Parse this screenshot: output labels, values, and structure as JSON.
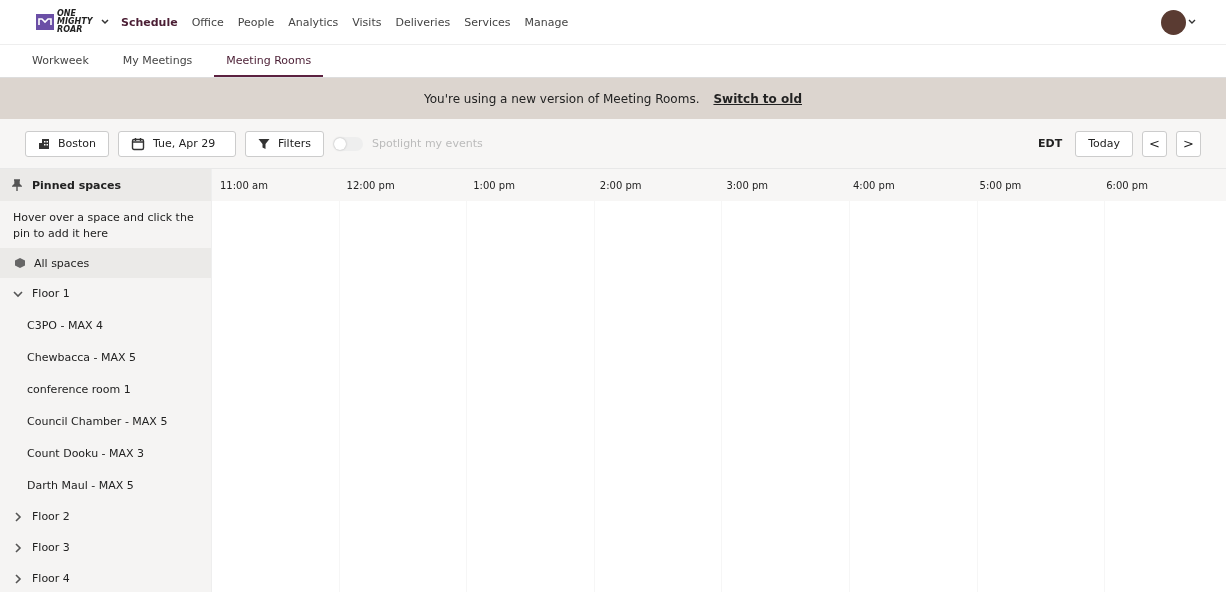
{
  "logo": {
    "text": "ONE MIGHTY ROAR"
  },
  "nav": [
    {
      "label": "Schedule",
      "selected": true
    },
    {
      "label": "Office",
      "selected": false
    },
    {
      "label": "People",
      "selected": false
    },
    {
      "label": "Analytics",
      "selected": false
    },
    {
      "label": "Visits",
      "selected": false
    },
    {
      "label": "Deliveries",
      "selected": false
    },
    {
      "label": "Services",
      "selected": false
    },
    {
      "label": "Manage",
      "selected": false
    }
  ],
  "tabs": [
    {
      "label": "Workweek",
      "selected": false
    },
    {
      "label": "My Meetings",
      "selected": false
    },
    {
      "label": "Meeting Rooms",
      "selected": true
    }
  ],
  "banner": {
    "text": "You're using a new version of Meeting Rooms.",
    "link": "Switch to old"
  },
  "toolbar": {
    "location": "Boston",
    "date": "Tue, Apr 29",
    "filters": "Filters",
    "spotlight": {
      "label": "Spotlight my events",
      "on": false
    },
    "timezone": "EDT",
    "today": "Today",
    "prev": "<",
    "next": ">"
  },
  "sidebar": {
    "pinned_title": "Pinned spaces",
    "pinned_hint": "Hover over a space and click the pin to add it here",
    "all_spaces": "All spaces",
    "floors": [
      {
        "label": "Floor 1",
        "expanded": true,
        "children": [
          {
            "label": "C3PO - MAX 4"
          },
          {
            "label": "Chewbacca - MAX 5"
          },
          {
            "label": "conference room 1"
          },
          {
            "label": "Council Chamber - MAX 5"
          },
          {
            "label": "Count Dooku - MAX 3"
          },
          {
            "label": "Darth Maul - MAX 5"
          }
        ]
      },
      {
        "label": "Floor 2",
        "expanded": false
      },
      {
        "label": "Floor 3",
        "expanded": false
      },
      {
        "label": "Floor 4",
        "expanded": false
      }
    ]
  },
  "timeline": {
    "hours": [
      "11:00 am",
      "12:00 pm",
      "1:00 pm",
      "2:00 pm",
      "3:00 pm",
      "4:00 pm",
      "5:00 pm",
      "6:00 pm"
    ]
  }
}
